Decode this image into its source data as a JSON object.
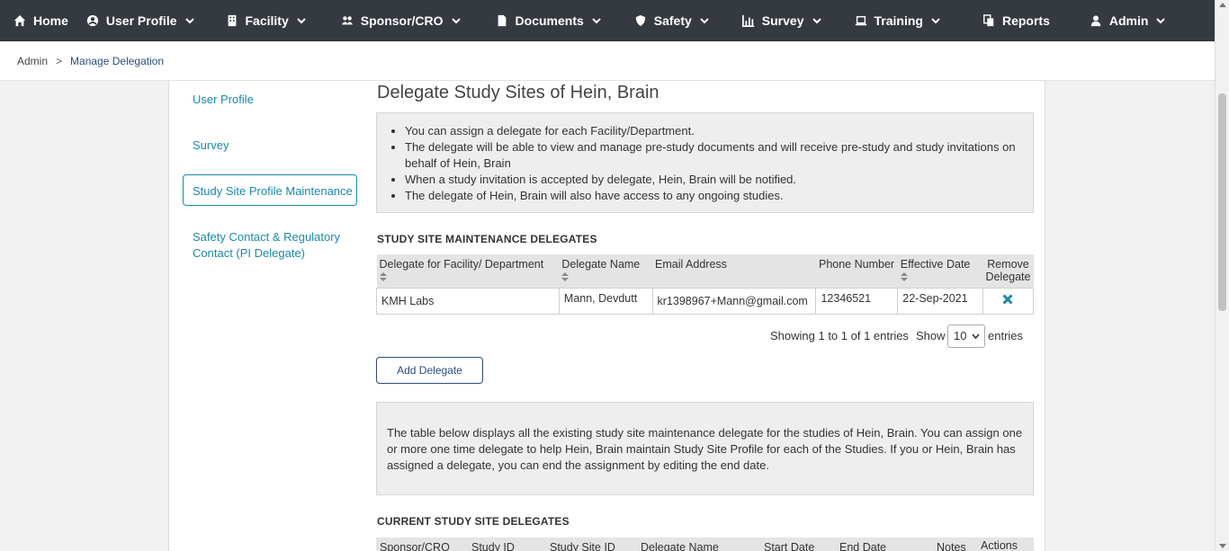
{
  "nav": {
    "items": [
      {
        "label": "Home",
        "icon": "home-icon",
        "caret": false
      },
      {
        "label": "User Profile",
        "icon": "user-circle-icon",
        "caret": true
      },
      {
        "label": "Facility",
        "icon": "building-icon",
        "caret": true
      },
      {
        "label": "Sponsor/CRO",
        "icon": "users-icon",
        "caret": true
      },
      {
        "label": "Documents",
        "icon": "file-icon",
        "caret": true
      },
      {
        "label": "Safety",
        "icon": "shield-icon",
        "caret": true
      },
      {
        "label": "Survey",
        "icon": "bar-chart-icon",
        "caret": true
      },
      {
        "label": "Training",
        "icon": "laptop-icon",
        "caret": true
      },
      {
        "label": "Reports",
        "icon": "copy-icon",
        "caret": false
      },
      {
        "label": "Admin",
        "icon": "user-icon",
        "caret": true
      }
    ]
  },
  "breadcrumb": {
    "root": "Admin",
    "separator": ">",
    "current": "Manage Delegation"
  },
  "sidebar": {
    "items": [
      {
        "label": "User Profile"
      },
      {
        "label": "Survey"
      },
      {
        "label": "Study Site Profile Maintenance",
        "active": true
      },
      {
        "label": "Safety Contact & Regulatory Contact (PI Delegate)"
      }
    ]
  },
  "main": {
    "title": "Delegate Study Sites of Hein, Brain",
    "info_bullets": [
      "You can assign a delegate for each Facility/Department.",
      "The delegate will be able to view and manage pre-study documents and will receive pre-study and study invitations on behalf of Hein, Brain",
      "When a study invitation is accepted by delegate, Hein, Brain will be notified.",
      "The delegate of Hein, Brain will also have access to any ongoing studies."
    ],
    "maintenance_heading": "STUDY SITE MAINTENANCE DELEGATES",
    "table": {
      "columns": [
        "Delegate for Facility/ Department",
        "Delegate Name",
        "Email Address",
        "Phone Number",
        "Effective Date",
        "Remove Delegate"
      ],
      "rows": [
        {
          "facility": "KMH Labs",
          "name": "Mann, Devdutt",
          "email": "kr1398967+Mann@gmail.com",
          "phone": "12346521",
          "effective": "22-Sep-2021"
        }
      ]
    },
    "showing": "Showing 1 to 1 of 1 entries",
    "show_label": "Show",
    "page_size": "10",
    "entries_label": "entries",
    "add_button": "Add Delegate",
    "info2": "The table below displays all the existing study site maintenance delegate for the studies of Hein, Brain. You can assign one or more one time delegate to help Hein, Brain maintain Study Site Profile for each of the Studies. If you or Hein, Brain has assigned a delegate, you can end the assignment by editing the end date.",
    "current_heading": "CURRENT STUDY SITE DELEGATES",
    "current_columns": [
      "Sponsor/CRO",
      "Study ID",
      "Study Site ID",
      "Delegate Name",
      "Start Date",
      "End Date",
      "Notes",
      "Actions"
    ]
  },
  "colors": {
    "nav_bg": "#343a40",
    "link": "#1a8aa8",
    "accent": "#2b4c7e",
    "remove": "#1a8aa8"
  }
}
